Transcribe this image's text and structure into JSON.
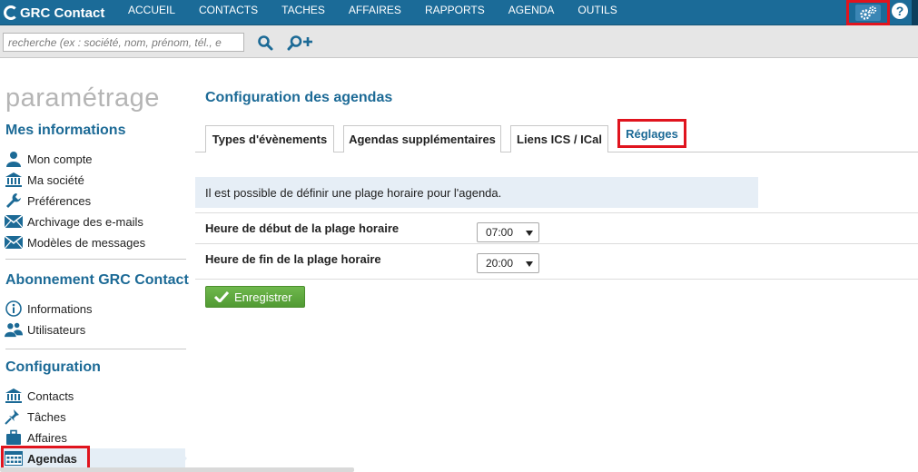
{
  "app": {
    "logo_text": "GRC Contact"
  },
  "nav": {
    "items": [
      "ACCUEIL",
      "CONTACTS",
      "TACHES",
      "AFFAIRES",
      "RAPPORTS",
      "AGENDA",
      "OUTILS"
    ],
    "help_label": "?"
  },
  "search": {
    "placeholder": "recherche (ex : société, nom, prénom, tél., e"
  },
  "sidebar": {
    "title": "paramétrage",
    "section1": {
      "heading": "Mes informations",
      "items": [
        "Mon compte",
        "Ma société",
        "Préférences",
        "Archivage des e-mails",
        "Modèles de messages"
      ]
    },
    "section2": {
      "heading": "Abonnement GRC Contact",
      "items": [
        "Informations",
        "Utilisateurs"
      ]
    },
    "section3": {
      "heading": "Configuration",
      "items": [
        "Contacts",
        "Tâches",
        "Affaires",
        "Agendas"
      ]
    }
  },
  "main": {
    "title": "Configuration des agendas",
    "tabs": [
      {
        "label": "Types d'évènements"
      },
      {
        "label": "Agendas supplémentaires"
      },
      {
        "label": "Liens ICS / ICal"
      },
      {
        "label": "Réglages"
      }
    ],
    "info": "Il est possible de définir une plage horaire pour l'agenda.",
    "start_label": "Heure de début de la plage horaire",
    "start_value": "07:00",
    "end_label": "Heure de fin de la plage horaire",
    "end_value": "20:00",
    "save_label": "Enregistrer"
  },
  "colors": {
    "topbar": "#1b6b98",
    "accent": "#1c6a96",
    "highlight_border": "#e0141e",
    "save_button": "#5ea63f"
  }
}
